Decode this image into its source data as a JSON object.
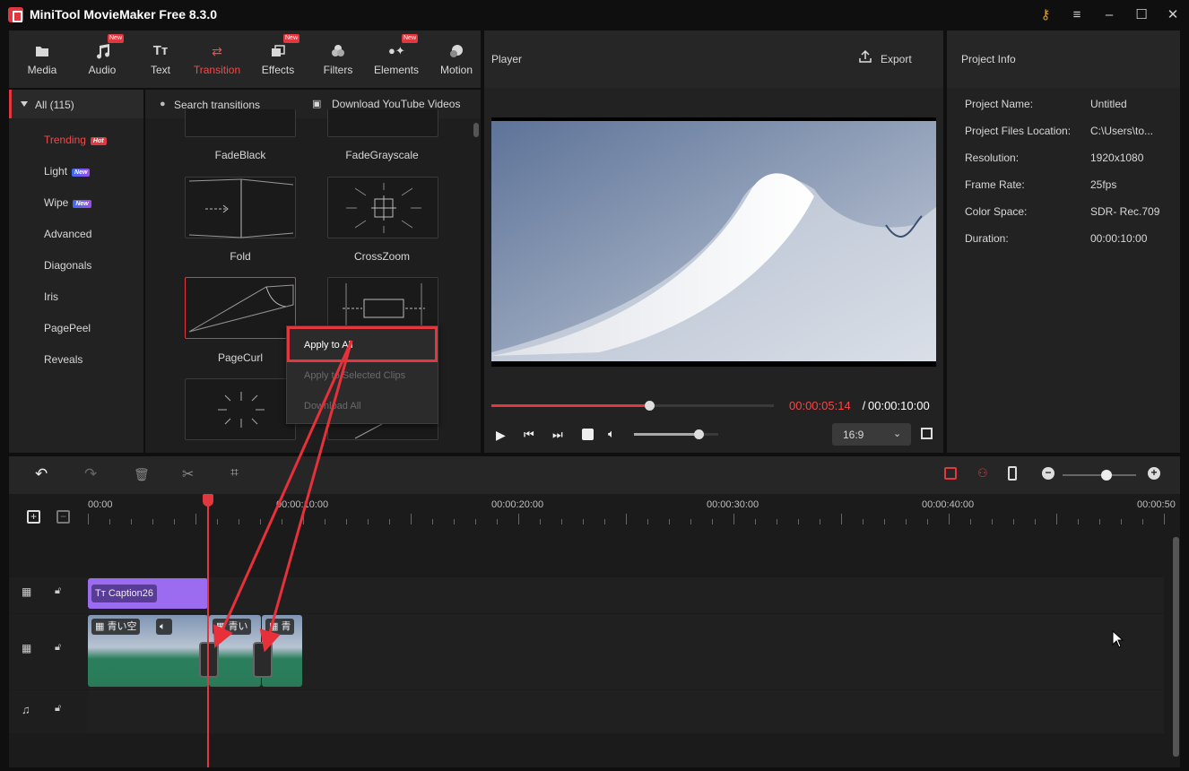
{
  "app": {
    "title": "MiniTool MovieMaker Free 8.3.0"
  },
  "toolbar": {
    "items": [
      {
        "label": "Media",
        "new": ""
      },
      {
        "label": "Audio",
        "new": "New"
      },
      {
        "label": "Text",
        "new": ""
      },
      {
        "label": "Transition",
        "new": ""
      },
      {
        "label": "Effects",
        "new": "New"
      },
      {
        "label": "Filters",
        "new": ""
      },
      {
        "label": "Elements",
        "new": "New"
      },
      {
        "label": "Motion",
        "new": ""
      }
    ]
  },
  "sidebar": {
    "header": "All (115)",
    "items": [
      {
        "label": "Trending",
        "tag": "Hot"
      },
      {
        "label": "Light",
        "tag": "New"
      },
      {
        "label": "Wipe",
        "tag": "New"
      },
      {
        "label": "Advanced",
        "tag": ""
      },
      {
        "label": "Diagonals",
        "tag": ""
      },
      {
        "label": "Iris",
        "tag": ""
      },
      {
        "label": "PagePeel",
        "tag": ""
      },
      {
        "label": "Reveals",
        "tag": ""
      }
    ]
  },
  "library": {
    "search_placeholder": "Search transitions",
    "download_label": "Download YouTube Videos",
    "transitions": [
      "FadeBlack",
      "FadeGrayscale",
      "Fold",
      "CrossZoom",
      "PageCurl"
    ]
  },
  "context_menu": {
    "items": [
      "Apply to All",
      "Apply to Selected Clips",
      "Download All"
    ]
  },
  "player": {
    "title": "Player",
    "export_label": "Export",
    "current_time": "00:00:05:14",
    "separator": " / ",
    "total_time": "00:00:10:00",
    "aspect_ratio": "16:9",
    "progress": 0.56,
    "volume": 0.77
  },
  "project_info": {
    "title": "Project Info",
    "rows": [
      {
        "label": "Project Name:",
        "value": "Untitled"
      },
      {
        "label": "Project Files Location:",
        "value": "C:\\Users\\to..."
      },
      {
        "label": "Resolution:",
        "value": "1920x1080"
      },
      {
        "label": "Frame Rate:",
        "value": "25fps"
      },
      {
        "label": "Color Space:",
        "value": "SDR- Rec.709"
      },
      {
        "label": "Duration:",
        "value": "00:00:10:00"
      }
    ]
  },
  "timeline": {
    "ruler": [
      "00:00",
      "00:00:10:00",
      "00:00:20:00",
      "00:00:30:00",
      "00:00:40:00",
      "00:00:50"
    ],
    "caption_clip": "Caption26",
    "video_clips": [
      "青い空",
      "青い",
      "青"
    ],
    "zoom": 0.6
  },
  "colors": {
    "accent": "#e0383e",
    "caption": "#9b6cf0",
    "panel": "#222222"
  }
}
